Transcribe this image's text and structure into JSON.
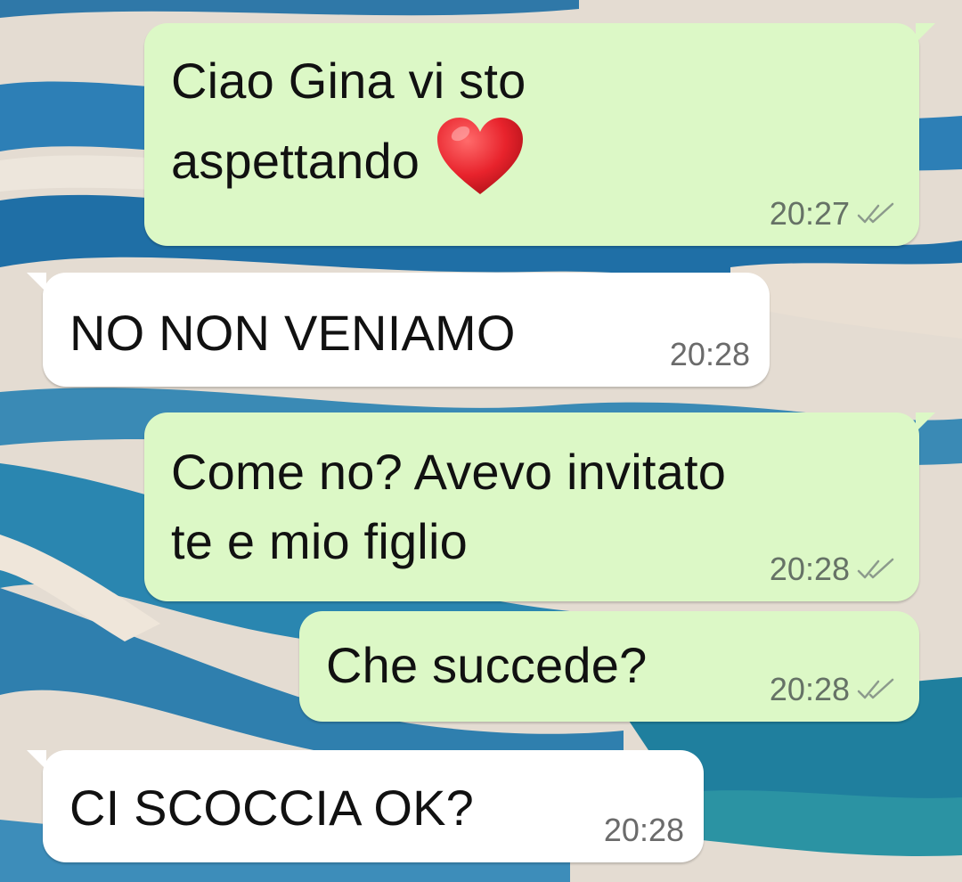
{
  "colors": {
    "outgoing_bubble": "#dcf8c6",
    "incoming_bubble": "#ffffff",
    "timestamp": "#667266",
    "ticks": "#8c9a8c",
    "heart": "#e8232c"
  },
  "messages": [
    {
      "direction": "outgoing",
      "text": "Ciao Gina vi sto\naspettando",
      "emoji": "heart-emoji",
      "time": "20:27",
      "status": "read-double-tick"
    },
    {
      "direction": "incoming",
      "text": "NO NON VENIAMO",
      "time": "20:28"
    },
    {
      "direction": "outgoing",
      "text": "Come no? Avevo invitato\nte e mio figlio",
      "time": "20:28",
      "status": "read-double-tick"
    },
    {
      "direction": "outgoing",
      "text": "Che succede?",
      "time": "20:28",
      "status": "read-double-tick"
    },
    {
      "direction": "incoming",
      "text": "CI SCOCCIA OK?",
      "time": "20:28"
    }
  ]
}
